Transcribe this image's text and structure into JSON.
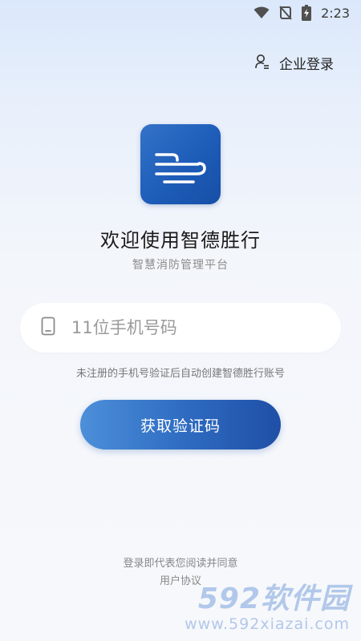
{
  "status_bar": {
    "time": "2:23",
    "icons": [
      "wifi-icon",
      "no-signal-icon",
      "battery-charging-icon"
    ]
  },
  "header": {
    "enterprise_login_label": "企业登录",
    "enterprise_login_icon": "user-list-icon"
  },
  "app": {
    "logo_icon": "app-logo-icon",
    "title": "欢迎使用智德胜行",
    "subtitle": "智慧消防管理平台"
  },
  "login_form": {
    "phone_icon": "mobile-phone-icon",
    "phone_placeholder": "11位手机号码",
    "phone_value": "",
    "hint": "未注册的手机号验证后自动创建智德胜行账号",
    "get_code_label": "获取验证码"
  },
  "footer": {
    "agreement_text": "登录即代表您阅读并同意",
    "agreement_link": "用户协议"
  },
  "watermark": {
    "brand": "592软件园",
    "url": "www.592xiazai.com"
  },
  "colors": {
    "accent": "#2f6dc2",
    "button_gradient_start": "#4d8fd9",
    "button_gradient_end": "#1f4fa6",
    "logo_bg": "#1d5cb8"
  }
}
